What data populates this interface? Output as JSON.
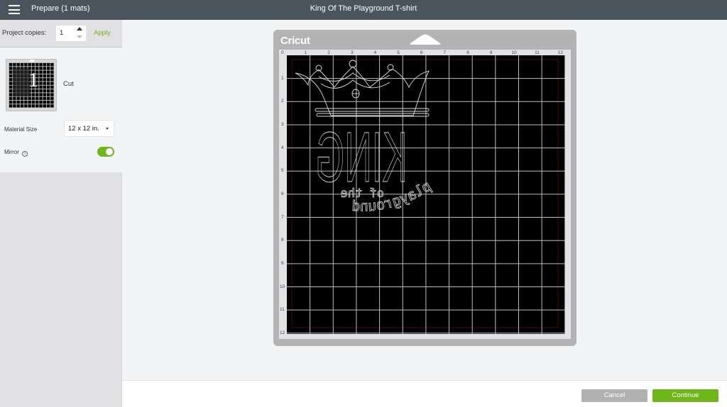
{
  "header": {
    "menu_icon": "hamburger-menu-icon",
    "left_title": "Prepare (1 mats)",
    "title": "King Of The Playground T-shirt"
  },
  "sidebar": {
    "project_copies_label": "Project copies:",
    "project_copies_value": "1",
    "apply_label": "Apply",
    "mats": [
      {
        "number": "1",
        "label": "Cut"
      }
    ],
    "material_size_label": "Material Size",
    "material_size_value": "12 x 12 in.",
    "mirror_label": "Mirror",
    "mirror_info_icon": "info-icon",
    "mirror_on": true
  },
  "mat": {
    "brand": "Cricut",
    "ruler_x": [
      "0",
      "1",
      "2",
      "3",
      "4",
      "5",
      "6",
      "7",
      "8",
      "9",
      "10",
      "11",
      "12"
    ],
    "ruler_y": [
      "1",
      "2",
      "3",
      "4",
      "5",
      "6",
      "7",
      "8",
      "9",
      "10",
      "11",
      "12"
    ],
    "design": {
      "mirrored_text": [
        "KING",
        "of the",
        "playground"
      ]
    }
  },
  "footer": {
    "cancel_label": "Cancel",
    "continue_label": "Continue"
  },
  "colors": {
    "header_bg": "#4a545d",
    "accent_green": "#6fb51c",
    "cancel_gray": "#b1b1b1",
    "mat_gray": "#b3b3b3",
    "mat_black": "#000000"
  }
}
